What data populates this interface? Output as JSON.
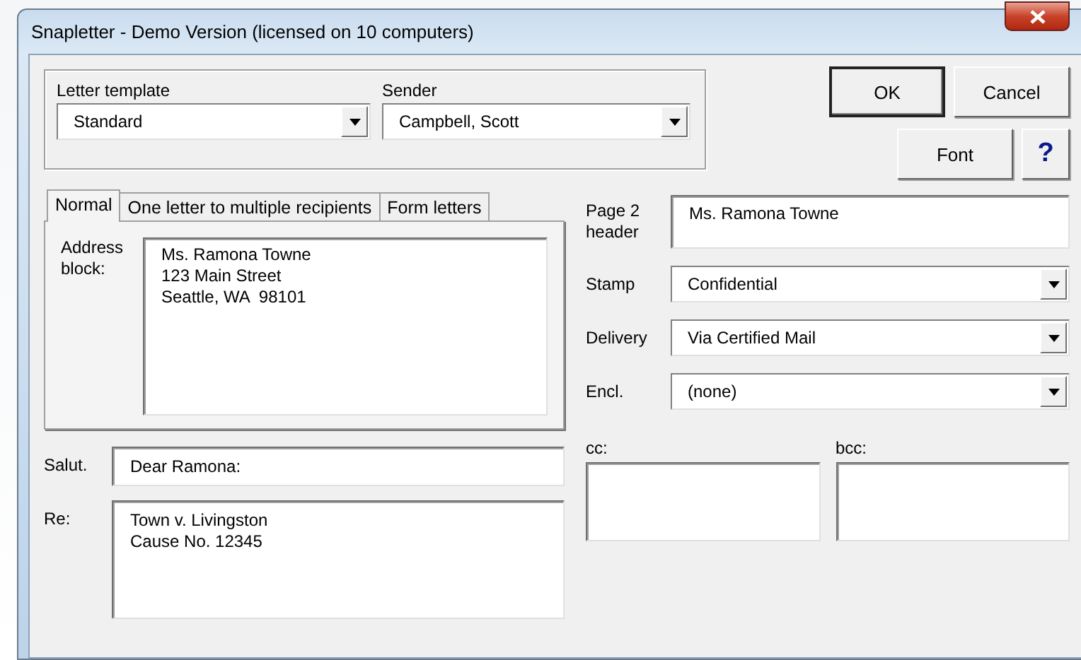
{
  "window": {
    "title": "Snapletter - Demo Version (licensed on 10 computers)"
  },
  "top_group": {
    "fields": [
      {
        "label": "Letter template",
        "value": "Standard"
      },
      {
        "label": "Sender",
        "value": "Campbell, Scott"
      }
    ]
  },
  "buttons": [
    {
      "label": "OK",
      "kind": "default"
    },
    {
      "label": "Cancel",
      "kind": "normal"
    },
    {
      "label": "Font",
      "kind": "normal"
    },
    {
      "label": "?",
      "kind": "help"
    }
  ],
  "tabs": [
    {
      "label": "Normal",
      "selected": true
    },
    {
      "label": "One letter to multiple recipients",
      "selected": false
    },
    {
      "label": "Form letters",
      "selected": false
    }
  ],
  "address": {
    "label": "Address block:",
    "value": "Ms. Ramona Towne\n123 Main Street\nSeattle, WA  98101"
  },
  "salutation": {
    "label": "Salut.",
    "value": "Dear Ramona:"
  },
  "re": {
    "label": "Re:",
    "value": "Town v. Livingston\nCause No. 12345"
  },
  "right_fields": [
    {
      "kind": "text",
      "label": "Page 2 header",
      "value": "Ms. Ramona Towne"
    },
    {
      "kind": "dropdown",
      "label": "Stamp",
      "value": "Confidential"
    },
    {
      "kind": "dropdown",
      "label": "Delivery",
      "value": "Via Certified Mail"
    },
    {
      "kind": "dropdown",
      "label": "Encl.",
      "value": "(none)"
    }
  ],
  "copies": [
    {
      "label": "cc:"
    },
    {
      "label": "bcc:"
    }
  ]
}
